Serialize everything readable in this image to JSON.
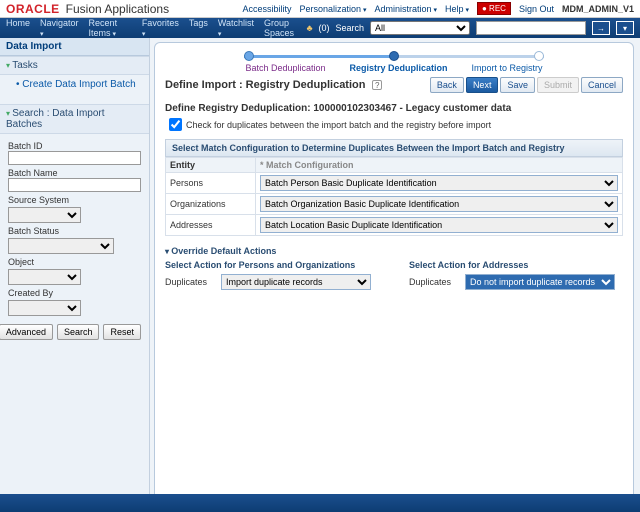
{
  "brand": {
    "oracle": "ORACLE",
    "app": "Fusion Applications"
  },
  "toplinks": {
    "accessibility": "Accessibility",
    "personalization": "Personalization",
    "administration": "Administration",
    "help": "Help",
    "signout": "Sign Out",
    "user": "MDM_ADMIN_V1",
    "rec": "● REC"
  },
  "menubar": {
    "home": "Home",
    "navigator": "Navigator",
    "recent": "Recent Items",
    "favorites": "Favorites",
    "tags": "Tags",
    "watchlist": "Watchlist",
    "spaces": "Group Spaces",
    "notif": "(0)",
    "searchlbl": "Search",
    "searchscope": "All"
  },
  "side": {
    "title": "Data Import",
    "tasks_h": "Tasks",
    "task1": "Create Data Import Batch",
    "search_h": "Search : Data Import Batches",
    "labels": {
      "batchid": "Batch ID",
      "batchname": "Batch Name",
      "sourcesys": "Source System",
      "batchstatus": "Batch Status",
      "object": "Object",
      "createdby": "Created By"
    },
    "buttons": {
      "advanced": "Advanced",
      "search": "Search",
      "reset": "Reset"
    }
  },
  "train": {
    "s1": "Batch Deduplication",
    "s2": "Registry Deduplication",
    "s3": "Import to Registry"
  },
  "page": {
    "title": "Define Import : Registry Deduplication"
  },
  "actions": {
    "back": "Back",
    "next": "Next",
    "save": "Save",
    "submit": "Submit",
    "cancel": "Cancel"
  },
  "section": {
    "heading": "Define Registry Deduplication: 100000102303467 - Legacy customer data",
    "checkbox": "Check for duplicates between the import batch and the registry before import"
  },
  "match": {
    "panel": "Select Match Configuration to Determine Duplicates Between the Import Batch and Registry",
    "h_entity": "Entity",
    "h_conf": "* Match Configuration",
    "r1": "Persons",
    "r1v": "Batch Person Basic Duplicate Identification",
    "r2": "Organizations",
    "r2v": "Batch Organization Basic Duplicate Identification",
    "r3": "Addresses",
    "r3v": "Batch Location Basic Duplicate Identification"
  },
  "override": {
    "heading": "Override Default Actions",
    "left_h": "Select Action for Persons and Organizations",
    "right_h": "Select Action for Addresses",
    "dup_lbl": "Duplicates",
    "left_v": "Import duplicate records",
    "right_v": "Do not import duplicate records"
  }
}
